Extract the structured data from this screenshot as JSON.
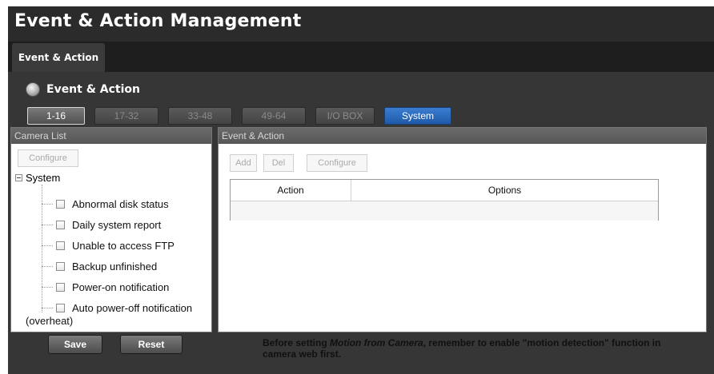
{
  "app": {
    "title": "Event & Action Management"
  },
  "tabs": [
    {
      "label": "Event & Action",
      "active": true
    }
  ],
  "section": {
    "title": "Event & Action"
  },
  "range_buttons": [
    {
      "label": "1-16",
      "state": "active"
    },
    {
      "label": "17-32",
      "state": "normal"
    },
    {
      "label": "33-48",
      "state": "normal"
    },
    {
      "label": "49-64",
      "state": "normal"
    },
    {
      "label": "I/O BOX",
      "state": "normal"
    },
    {
      "label": "System",
      "state": "selected"
    }
  ],
  "camera_list": {
    "header": "Camera List",
    "configure_label": "Configure",
    "root_label": "System",
    "items": [
      {
        "label": "Abnormal disk status",
        "checked": false
      },
      {
        "label": "Daily system report",
        "checked": false
      },
      {
        "label": "Unable to access FTP",
        "checked": false
      },
      {
        "label": "Backup unfinished",
        "checked": false
      },
      {
        "label": "Power-on notification",
        "checked": false
      },
      {
        "label": "Auto power-off notification",
        "label_cont": "(overheat)",
        "checked": false
      }
    ]
  },
  "event_action": {
    "header": "Event & Action",
    "add_label": "Add",
    "del_label": "Del",
    "configure_label": "Configure",
    "columns": [
      "Action",
      "Options"
    ],
    "rows": []
  },
  "footer": {
    "save_label": "Save",
    "reset_label": "Reset",
    "note_prefix": "Before setting ",
    "note_emph": "Motion from Camera",
    "note_suffix": ", remember to enable \"motion detection\" function in camera web first."
  },
  "colors": {
    "system_button": "#2a6bc0",
    "background": "#2b2b2b"
  },
  "icons": {
    "section_bullet": "bullet-icon",
    "tree_collapse": "minus-icon",
    "checkbox": "checkbox-icon"
  }
}
